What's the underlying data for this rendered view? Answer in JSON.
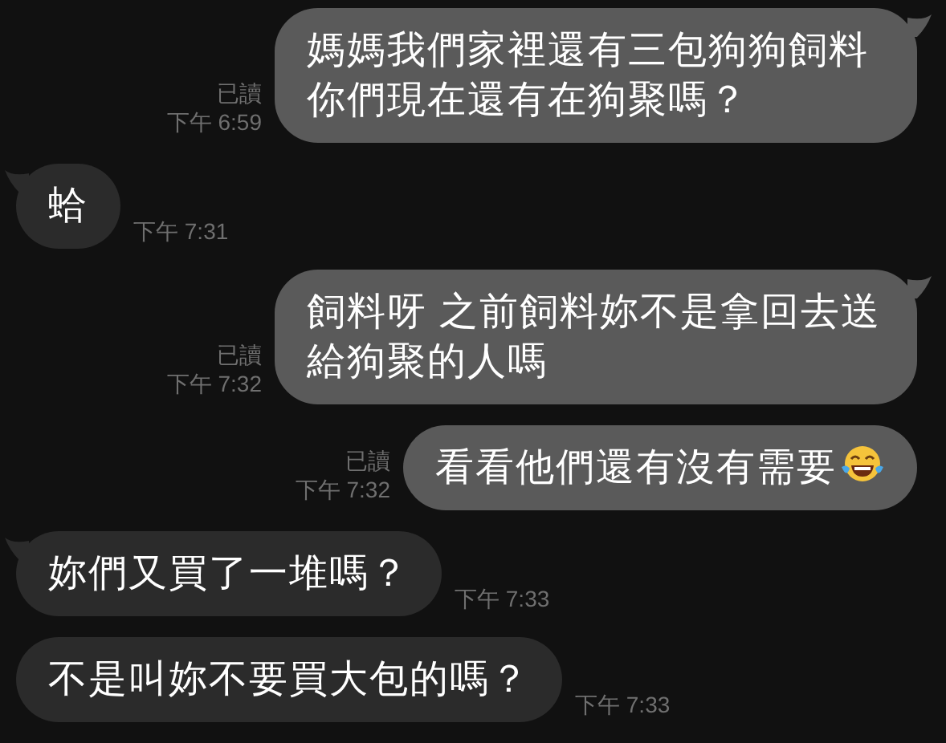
{
  "messages": [
    {
      "kind": "sent",
      "text": "媽媽我們家裡還有三包狗狗飼料你們現在還有在狗聚嗎？",
      "read": "已讀",
      "time": "下午 6:59",
      "tail": true
    },
    {
      "kind": "received",
      "text": "蛤",
      "time": "下午 7:31",
      "tail": true
    },
    {
      "kind": "sent",
      "text": "飼料呀 之前飼料妳不是拿回去送給狗聚的人嗎",
      "read": "已讀",
      "time": "下午 7:32",
      "tail": true
    },
    {
      "kind": "sent_emoji",
      "text": "看看他們還有沒有需要",
      "read": "已讀",
      "time": "下午 7:32",
      "tail": false
    },
    {
      "kind": "received",
      "text": "妳們又買了一堆嗎？",
      "time": "下午 7:33",
      "tail": true
    },
    {
      "kind": "received",
      "text": "不是叫妳不要買大包的嗎？",
      "time": "下午 7:33",
      "tail": false
    }
  ]
}
